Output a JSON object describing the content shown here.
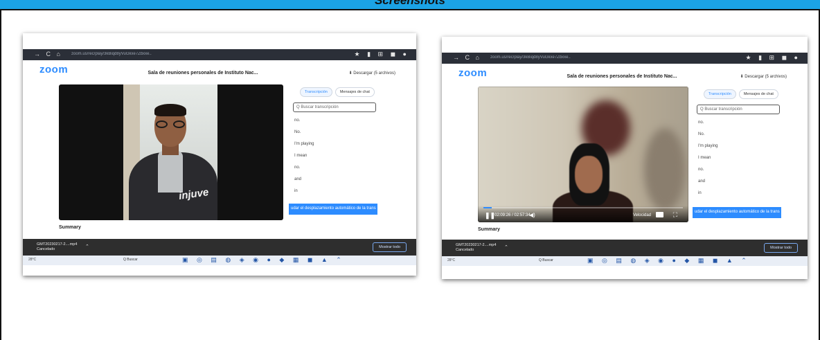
{
  "header": {
    "title": "Screenshots"
  },
  "screenshots": [
    {
      "browser": {
        "url": "zoom.us/rec/play/3kBiqd8yVuGkxe7Zbxxe..",
        "nav_icons": "→ C ⌂",
        "ext_icons": "★ ▮ ⊞ ◼ ●"
      },
      "zoom_logo": "zoom",
      "meeting_title": "Sala de reuniones personales de Instituto Nac...",
      "download_label": "⬇ Descargar (5 archivos)",
      "video": {
        "brand_text": "injuve",
        "is_playing": false
      },
      "transcript": {
        "tabs": [
          "Transcripción",
          "Mensajes de chat"
        ],
        "active_tab": "Transcripción",
        "search_placeholder": "Q Buscar transcripción",
        "lines": [
          "no.",
          "No.",
          "I'm playing",
          "I mean",
          "no.",
          "and",
          "in"
        ],
        "resume_banner": "udar el desplazamiento automático de la trans"
      },
      "summary_label": "Summary",
      "download_bar": {
        "file_name": "GMT20230217-2....mp4",
        "file_status": "Cancelado",
        "show_all": "Mostrar todo"
      },
      "taskbar": {
        "weather": "28°C",
        "search": "Q Buscar"
      }
    },
    {
      "browser": {
        "url": "zoom.us/rec/play/3kBiqd8yVuGkxe7Zbxxe..",
        "nav_icons": "→ C ⌂",
        "ext_icons": "★ ▮ ⊞ ◼ ●"
      },
      "zoom_logo": "zoom",
      "meeting_title": "Sala de reuniones personales de Instituto Nac...",
      "download_label": "⬇ Descargar (5 archivos)",
      "video": {
        "time": "02:09:26 / 02:57:34",
        "speed_label": "Velocidad",
        "progress": 0.04
      },
      "transcript": {
        "tabs": [
          "Transcripción",
          "Mensajes de chat"
        ],
        "active_tab": "Transcripción",
        "search_placeholder": "Q Buscar transcripción",
        "lines": [
          "no.",
          "No.",
          "I'm playing",
          "I mean",
          "no.",
          "and",
          "in"
        ],
        "resume_banner": "udar el desplazamiento automático de la trans"
      },
      "summary_label": "Summary",
      "download_bar": {
        "file_name": "GMT20230217-2....mp4",
        "file_status": "Cancelado",
        "show_all": "Mostrar todo"
      },
      "taskbar": {
        "weather": "28°C",
        "search": "Q Buscar"
      }
    }
  ],
  "colors": {
    "band": "#1ba3e6",
    "zoom_blue": "#2d8cff",
    "download_bar": "#2e2e2e"
  },
  "icons": [
    "play-pause-icon",
    "volume-icon",
    "captions-icon",
    "fullscreen-icon",
    "chevron-up-icon"
  ]
}
